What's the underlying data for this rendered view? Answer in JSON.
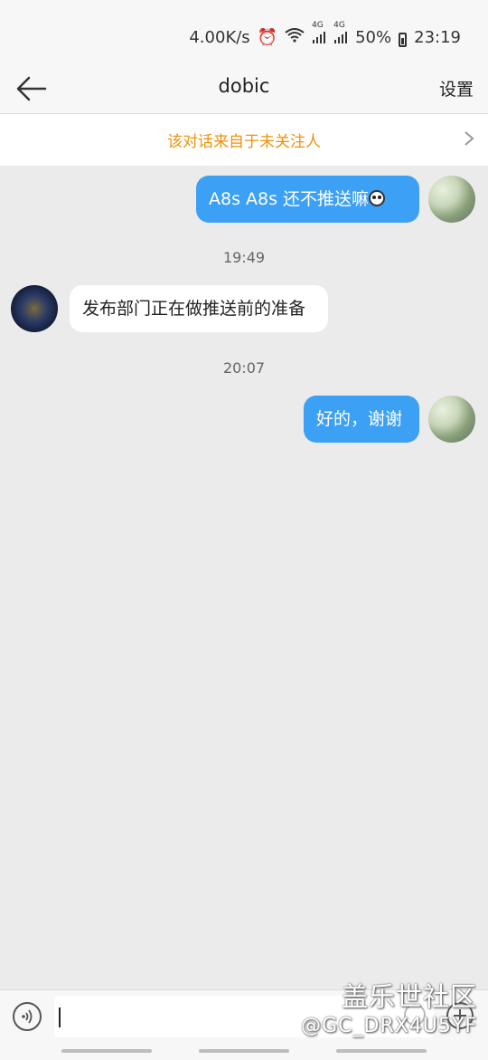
{
  "status_bar": {
    "speed": "4.00K/s",
    "signal_label_1": "4G",
    "signal_label_2": "4G",
    "battery": "50%",
    "time": "23:19"
  },
  "header": {
    "title": "dobic",
    "settings_label": "设置"
  },
  "banner": {
    "text": "该对话来自于未关注人"
  },
  "messages": [
    {
      "from": "self",
      "text": "A8s   A8s  还不推送嘛"
    },
    {
      "timestamp": "19:49"
    },
    {
      "from": "other",
      "text": "发布部门正在做推送前的准备"
    },
    {
      "timestamp": "20:07"
    },
    {
      "from": "self",
      "text": "好的，谢谢"
    }
  ],
  "input": {
    "value": ""
  },
  "watermark": {
    "line1": "盖乐世社区",
    "line2": "@GC_DRX4U5YF"
  },
  "colors": {
    "self_bubble": "#3ca0f5",
    "banner_text": "#f0900a",
    "background": "#ebebeb"
  }
}
